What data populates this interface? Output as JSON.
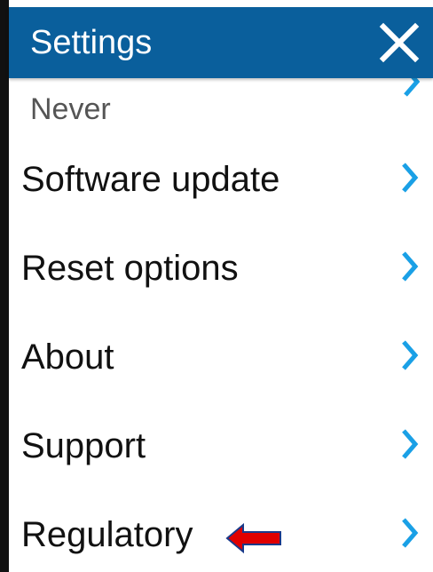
{
  "header": {
    "title": "Settings",
    "close_icon": "close-icon",
    "background": "#0a5f9c"
  },
  "partial_item": {
    "value": "Never",
    "icon": "chevron-right-icon"
  },
  "menu": {
    "items": [
      {
        "label": "Software update",
        "icon": "chevron-right-icon"
      },
      {
        "label": "Reset options",
        "icon": "chevron-right-icon"
      },
      {
        "label": "About",
        "icon": "chevron-right-icon"
      },
      {
        "label": "Support",
        "icon": "chevron-right-icon"
      },
      {
        "label": "Regulatory",
        "icon": "chevron-right-icon"
      }
    ]
  },
  "annotation": {
    "icon": "red-arrow-icon",
    "color": "#e00000"
  },
  "colors": {
    "accent": "#0a5f9c",
    "chevron": "#1aa0e6",
    "text": "#111111"
  }
}
